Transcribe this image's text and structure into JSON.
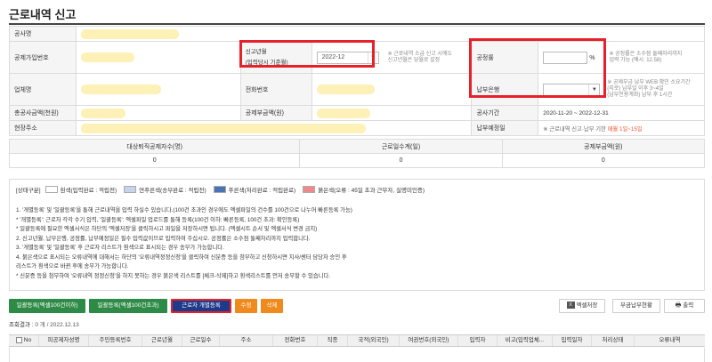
{
  "page": {
    "title": "근로내역 신고"
  },
  "info": {
    "company_label": "공사명",
    "insurance_no_label": "공제가입번호",
    "report_month_label_line1": "신고년월",
    "report_month_label_line2": "(입력당시 기준월)",
    "report_month_value": "2022-12",
    "report_month_note_line1": "※ 근로내역 소급 신고 시에도",
    "report_month_note_line2": "신고년월은 당월로 설정",
    "progress_label": "공정률",
    "progress_unit": "%",
    "progress_note_line1": "※ 공정률은 소수점 둘째자리까지",
    "progress_note_line2": "입력 가능 (예시: 12.58)",
    "business_name_label": "업체명",
    "phone_label": "전화번호",
    "bank_label": "납부은행",
    "bank_note_line1": "※ 공제부금 납부 WEB 확인 소요기간",
    "bank_note_line2": "(지로) 납부일 이후 3~4일",
    "bank_note_line3": "(납부전용계좌) 납부 후 1시간",
    "total_contract_label": "총공사금액(천원)",
    "contribution_label": "공제부금액(원)",
    "period_label": "공사기간",
    "period_value": "2020-11-20 ~ 2022-12-31",
    "site_address_label": "현장주소",
    "due_date_label": "납부예정일",
    "due_date_note": "※ 근로내역 신고·납부 기한",
    "due_date_highlight": "매월 1일~15일"
  },
  "summary": {
    "headers": [
      "대상퇴직공제자수(명)",
      "근로일수계(일)",
      "공제부금액(원)"
    ],
    "values": [
      "0",
      "0",
      "0"
    ]
  },
  "legend": {
    "prefix": "[상태구분]",
    "items": [
      {
        "label": "흰색(입력완료 : 적립전)",
        "color": "#ffffff"
      },
      {
        "label": "연푸른색(송부완료 : 적립전)",
        "color": "#c5d4ea"
      },
      {
        "label": "푸른색(처리완료 : 적립완료)",
        "color": "#4a73b8"
      },
      {
        "label": "붉은색(오류 : 45일 초과 근무자, 실명미인증)",
        "color": "#f08a8a"
      }
    ]
  },
  "notes": [
    "1. '개별등록' 및 '일괄등록'을 통해 근로내역을 입력 하실수 있습니다.(100건 초과인 경우에도 엑셀파일의 건수를 100건으로 나누어 빠른등록 가능)",
    "  * '개별등록': 근로자 각각 수기 입력, '일괄등록': 엑셀파일 업로드를 통해 등록(100건 이하: 빠른등록, 100건 초과: 확인등록)",
    "  * 일괄등록에 필요한 엑셀서식은 하단의 '엑셀저장'을 클릭하시고 파일을 저장하시면 됩니다. (엑셀시트 순서 및 엑셀서식 변경 금지)",
    "2. 신고년월, 납부은행, 공정률, 납부예정일은 필수 입력값이므로 입력하여 주십시오. 공정률은 소수점 둘째자리까지 입력합니다.",
    "3. '개별등록' 및 '일괄등록' 후 근로자 리스트가 흰색으로 표시되는 경우 송부가 가능합니다.",
    "4. 붉은색으로 표시되는 오류내역에 대해서는 하단의 '오류내역정정신청'을 클릭하여 신분증 등을 첨부하고 신청하시면 지사/센터 담당자 승인 후",
    "   리스트가 흰색으로 바뀐 후에 송부가 가능합니다.",
    "  * 신분증 등을 첨부하여 '오류내역 정정신청'을 하지 못하는 경우 붉은색 리스트를 [체크-삭제]하고 흰색리스트를 먼저 송부할 수 있습니다."
  ],
  "buttons": {
    "bulk_fast": "일괄등록(엑셀100건이하)",
    "bulk_confirm": "일괄등록(엑셀100건초과)",
    "individual": "근로자 개별등록",
    "edit": "수정",
    "delete": "삭제",
    "excel_save": "엑셀저장",
    "payment_status": "부금납부현황",
    "print": "출력"
  },
  "result": {
    "label": "조회결과",
    "count": ": 0 개",
    "date": "/ 2022.12.13"
  },
  "grid": {
    "columns": [
      "No",
      "피공제자성명",
      "주민등록번호",
      "근로년월",
      "근로일수",
      "주소",
      "전화번호",
      "직종",
      "국적(외국인)",
      "여권번호(외국인)",
      "입력자",
      "비고(입력업체...",
      "입력일자",
      "처리상태",
      "오류내역"
    ]
  }
}
